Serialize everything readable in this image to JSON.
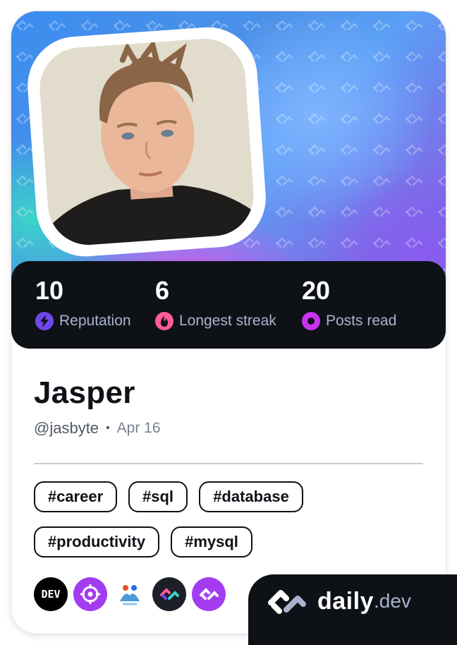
{
  "profile": {
    "name": "Jasper",
    "handle": "@jasbyte",
    "separator": "•",
    "date": "Apr 16",
    "avatar_alt": "profile-photo"
  },
  "stats": [
    {
      "value": "10",
      "label": "Reputation",
      "icon": "lightning-icon",
      "color": "#7147ed"
    },
    {
      "value": "6",
      "label": "Longest streak",
      "icon": "flame-icon",
      "color": "#ff5c9a"
    },
    {
      "value": "20",
      "label": "Posts read",
      "icon": "eye-ring-icon",
      "color": "#c833f0"
    }
  ],
  "tags": [
    "#career",
    "#sql",
    "#database",
    "#productivity",
    "#mysql"
  ],
  "sources": [
    {
      "name": "dev-to-icon",
      "text": "DEV",
      "color": "#000000"
    },
    {
      "name": "crosshair-source-icon",
      "text": "",
      "color": "#a33cf0"
    },
    {
      "name": "people-source-icon",
      "text": "",
      "color": "#ffffff"
    },
    {
      "name": "daily-gradient-source-icon",
      "text": "",
      "color": "#1c1f26"
    },
    {
      "name": "daily-purple-source-icon",
      "text": "",
      "color": "#a33cf0"
    }
  ],
  "brand": {
    "daily": "daily",
    "dev": ".dev"
  },
  "colors": {
    "dark": "#0e1217",
    "stat_label": "#a8b3cf",
    "accent_purple": "#7147ed",
    "accent_pink": "#ff5c9a",
    "accent_magenta": "#c833f0"
  }
}
